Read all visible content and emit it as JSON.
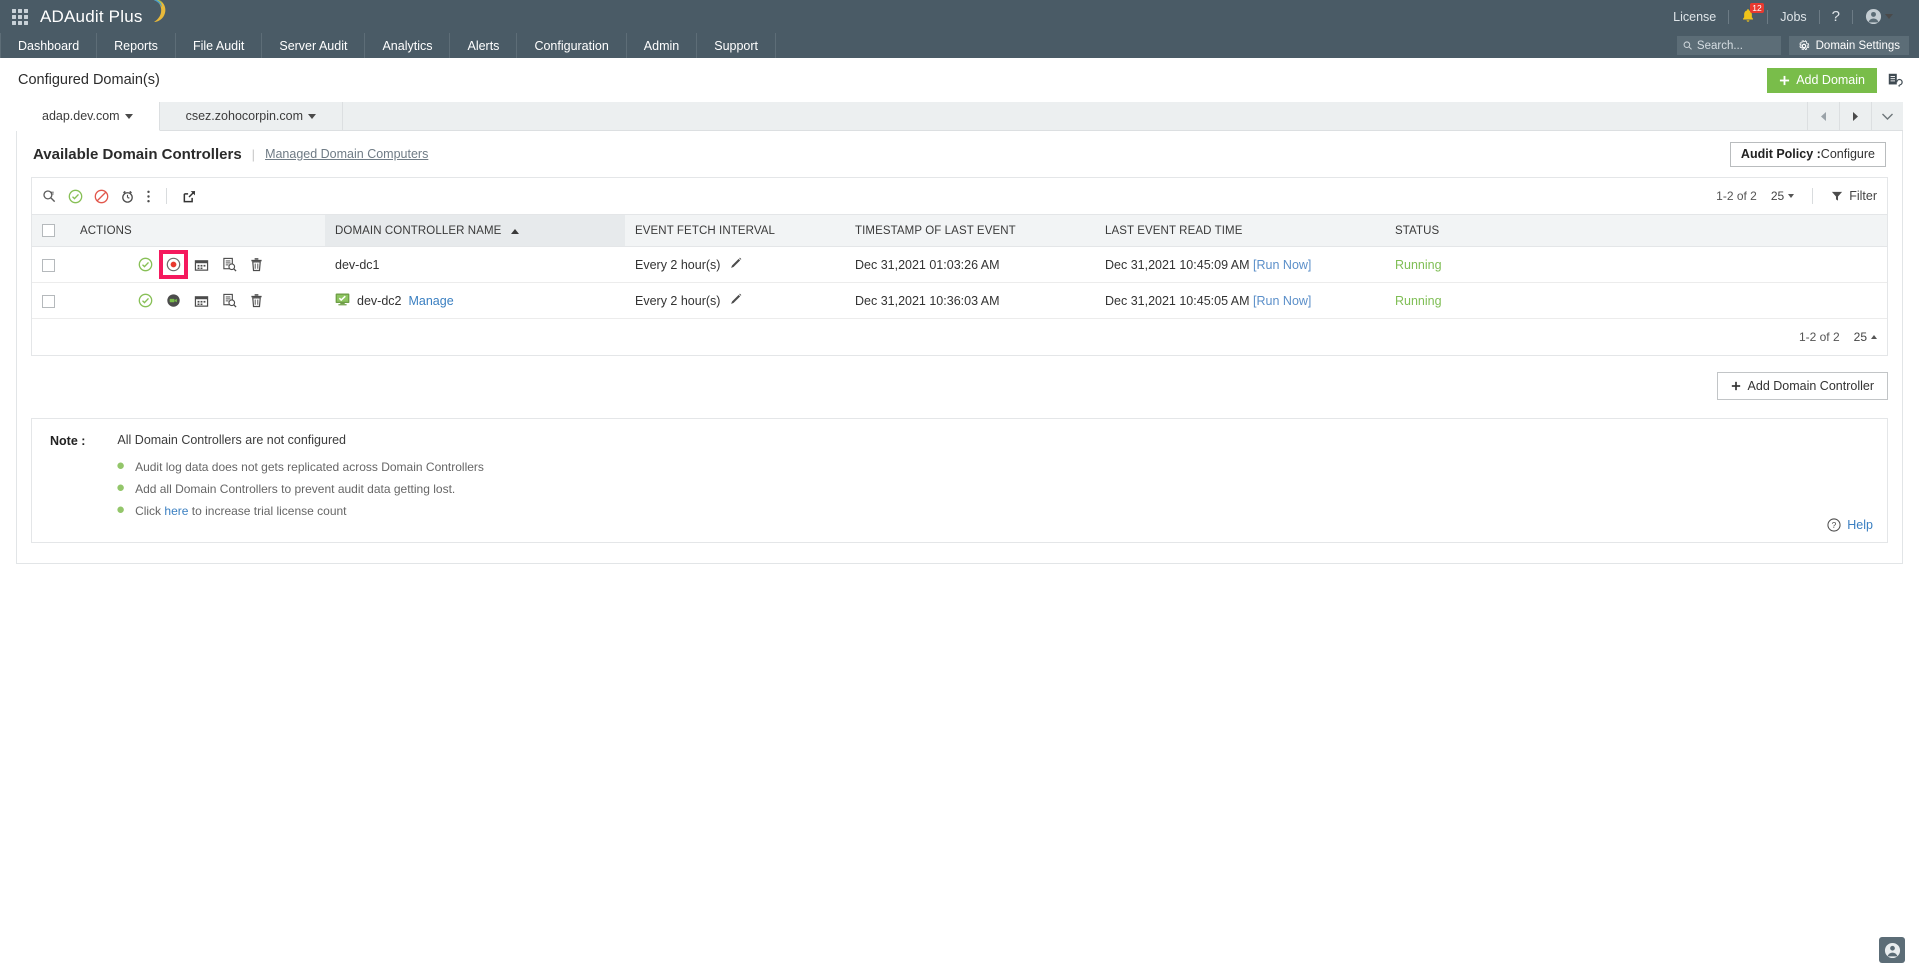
{
  "header": {
    "brand": "ADAudit Plus",
    "apps_icon": "grid-apps-icon",
    "license_label": "License",
    "notifications_count": "12",
    "jobs_label": "Jobs",
    "help_label": "?",
    "nav_items": [
      "Dashboard",
      "Reports",
      "File Audit",
      "Server Audit",
      "Analytics",
      "Alerts",
      "Configuration",
      "Admin",
      "Support"
    ],
    "search_placeholder": "Search...",
    "domain_settings_label": "Domain Settings"
  },
  "page": {
    "title": "Configured Domain(s)",
    "add_domain_label": "Add Domain"
  },
  "domain_tabs": [
    {
      "label": "adap.dev.com",
      "active": true
    },
    {
      "label": "csez.zohocorpin.com",
      "active": false
    }
  ],
  "section": {
    "title": "Available Domain Controllers",
    "separator": "|",
    "managed_link": "Managed Domain Computers",
    "audit_policy_label": "Audit Policy :",
    "audit_policy_value": "Configure"
  },
  "toolbar": {
    "icons": [
      "search-dc-icon",
      "enable-icon",
      "disable-icon",
      "schedule-alarm-icon",
      "more-options-icon",
      "export-icon"
    ],
    "pagination_text": "1-2 of 2",
    "page_size": "25",
    "filter_label": "Filter"
  },
  "table": {
    "columns": [
      "ACTIONS",
      "DOMAIN CONTROLLER NAME",
      "EVENT FETCH INTERVAL",
      "TIMESTAMP OF LAST EVENT",
      "LAST EVENT READ TIME",
      "STATUS"
    ],
    "sorted_column": "DOMAIN CONTROLLER NAME",
    "sort_direction": "asc",
    "rows": [
      {
        "selected": false,
        "actions": [
          "enabled-check-icon",
          "record-stop-icon",
          "calendar-icon",
          "report-search-icon",
          "delete-icon"
        ],
        "highlighted_action_index": 1,
        "has_computer_icon": false,
        "name": "dev-dc1",
        "manage_link": "",
        "interval": "Every 2 hour(s)",
        "timestamp_last_event": "Dec 31,2021 01:03:26 AM",
        "last_event_read_time": "Dec 31,2021 10:45:09 AM",
        "run_now": "[Run Now]",
        "status": "Running"
      },
      {
        "selected": false,
        "actions": [
          "enabled-check-icon",
          "camera-record-icon",
          "calendar-icon",
          "report-search-icon",
          "delete-icon"
        ],
        "highlighted_action_index": -1,
        "has_computer_icon": true,
        "name": "dev-dc2",
        "manage_link": "Manage",
        "interval": "Every 2 hour(s)",
        "timestamp_last_event": "Dec 31,2021 10:36:03 AM",
        "last_event_read_time": "Dec 31,2021 10:45:05 AM",
        "run_now": "[Run Now]",
        "status": "Running"
      }
    ],
    "footer_pagination": "1-2 of 2",
    "footer_page_size": "25"
  },
  "add_domain_controller_label": "Add Domain Controller",
  "note": {
    "label": "Note :",
    "headline": "All Domain Controllers are not configured",
    "items": [
      "Audit log data does not gets replicated across Domain Controllers",
      "Add all Domain Controllers to prevent audit data getting lost.",
      "Click here to increase trial license count"
    ],
    "item3_prefix": "Click ",
    "item3_link": "here",
    "item3_suffix": " to increase trial license count",
    "help_label": "Help"
  },
  "colors": {
    "header_bg": "#4a5b66",
    "accent_green": "#79bd4a",
    "status_green": "#7fbe55",
    "link_blue": "#3a7fc1",
    "highlight_pink": "#f5195e",
    "record_red": "#e8392f"
  }
}
